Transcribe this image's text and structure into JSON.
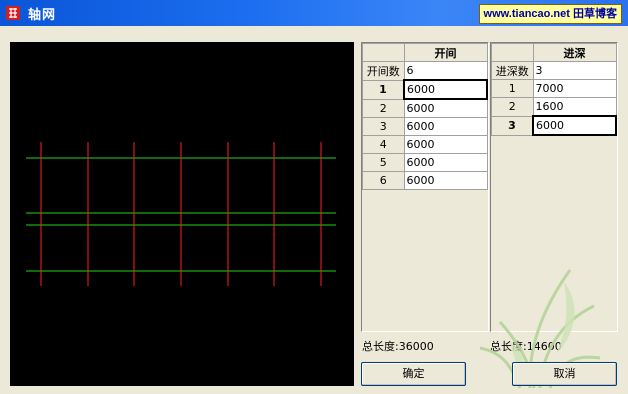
{
  "window": {
    "title": "轴网",
    "brand": "www.tiancao.net 田草博客"
  },
  "bays": {
    "header": "开间",
    "count_label": "开间数",
    "count_value": "6",
    "rows": [
      {
        "index": "1",
        "value": "6000"
      },
      {
        "index": "2",
        "value": "6000"
      },
      {
        "index": "3",
        "value": "6000"
      },
      {
        "index": "4",
        "value": "6000"
      },
      {
        "index": "5",
        "value": "6000"
      },
      {
        "index": "6",
        "value": "6000"
      }
    ],
    "total": "总长度:36000"
  },
  "depths": {
    "header": "进深",
    "count_label": "进深数",
    "count_value": "3",
    "rows": [
      {
        "index": "1",
        "value": "7000"
      },
      {
        "index": "2",
        "value": "1600"
      },
      {
        "index": "3",
        "value": "6000"
      }
    ],
    "total": "总长度:14600"
  },
  "buttons": {
    "ok": "确定",
    "cancel": "取消"
  },
  "colors": {
    "vertical_axis": "#ff2020",
    "horizontal_axis": "#20d020",
    "canvas_bg": "#000000"
  }
}
